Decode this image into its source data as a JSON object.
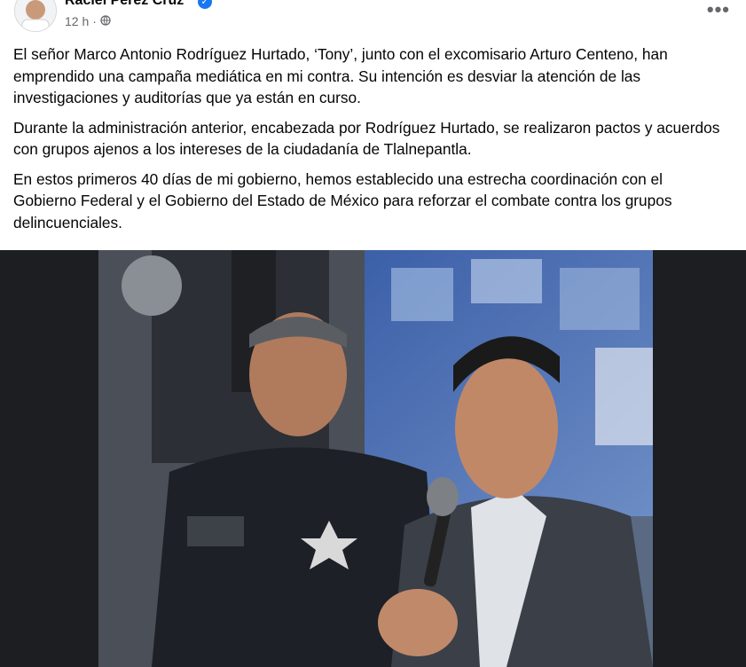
{
  "post": {
    "author": "Raciel Pérez Cruz",
    "time": "12 h",
    "separator": "·",
    "privacy_icon": "globe-icon",
    "more_icon": "more-horizontal-icon",
    "verified_icon": "verified-badge-icon",
    "paragraphs": [
      "El señor Marco Antonio Rodríguez Hurtado, ‘Tony’, junto con el excomisario Arturo Centeno, han emprendido una campaña mediática en mi contra. Su intención es desviar la atención de las investigaciones y auditorías que ya están en curso.",
      "Durante la administración anterior, encabezada por Rodríguez Hurtado, se realizaron pactos y acuerdos con grupos ajenos a los intereses de la ciudadanía de Tlalnepantla.",
      "En estos primeros 40 días de mi gobierno, hemos establecido una estrecha coordinación con el Gobierno Federal y el Gobierno del Estado de México para reforzar el combate contra los grupos delincuenciales."
    ]
  },
  "colors": {
    "text": "#050505",
    "meta": "#65676b",
    "verified": "#1877f2",
    "photo_backdrop": "#1c1e21"
  }
}
